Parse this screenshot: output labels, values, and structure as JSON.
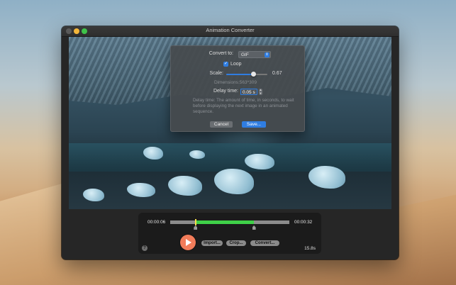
{
  "window": {
    "title": "Animation Converter"
  },
  "dialog": {
    "convert_to_label": "Convert to:",
    "format_selected": "GIF",
    "loop_label": "Loop",
    "loop_checked": true,
    "scale_label": "Scale:",
    "scale_value": "0.67",
    "scale_fraction": 0.67,
    "dimensions_text": "Dimensions:563*309",
    "delay_label": "Delay time:",
    "delay_value": "0.05 s",
    "help_text": "Delay time: The amount of time, in seconds, to wait before displaying the next image in an animated sequence.",
    "cancel_label": "Cancel",
    "save_label": "Save..."
  },
  "controls": {
    "time_start": "00:00:06",
    "time_end": "00:00:32",
    "duration": "15.8s",
    "import_label": "Import...",
    "crop_label": "Crop...",
    "convert_label": "Convert...",
    "help_icon": "?",
    "trim_start_fraction": 0.21,
    "trim_end_fraction": 0.7,
    "playhead_fraction": 0.21
  },
  "icons": {
    "checkmark": "check-icon",
    "select_arrows": "chevron-updown-icon",
    "play": "play-icon",
    "help": "question-icon"
  },
  "colors": {
    "accent": "#2f7de1",
    "play_button": "#f27c5a",
    "timeline_selection": "#3fd048",
    "playhead": "#f4e14a"
  }
}
